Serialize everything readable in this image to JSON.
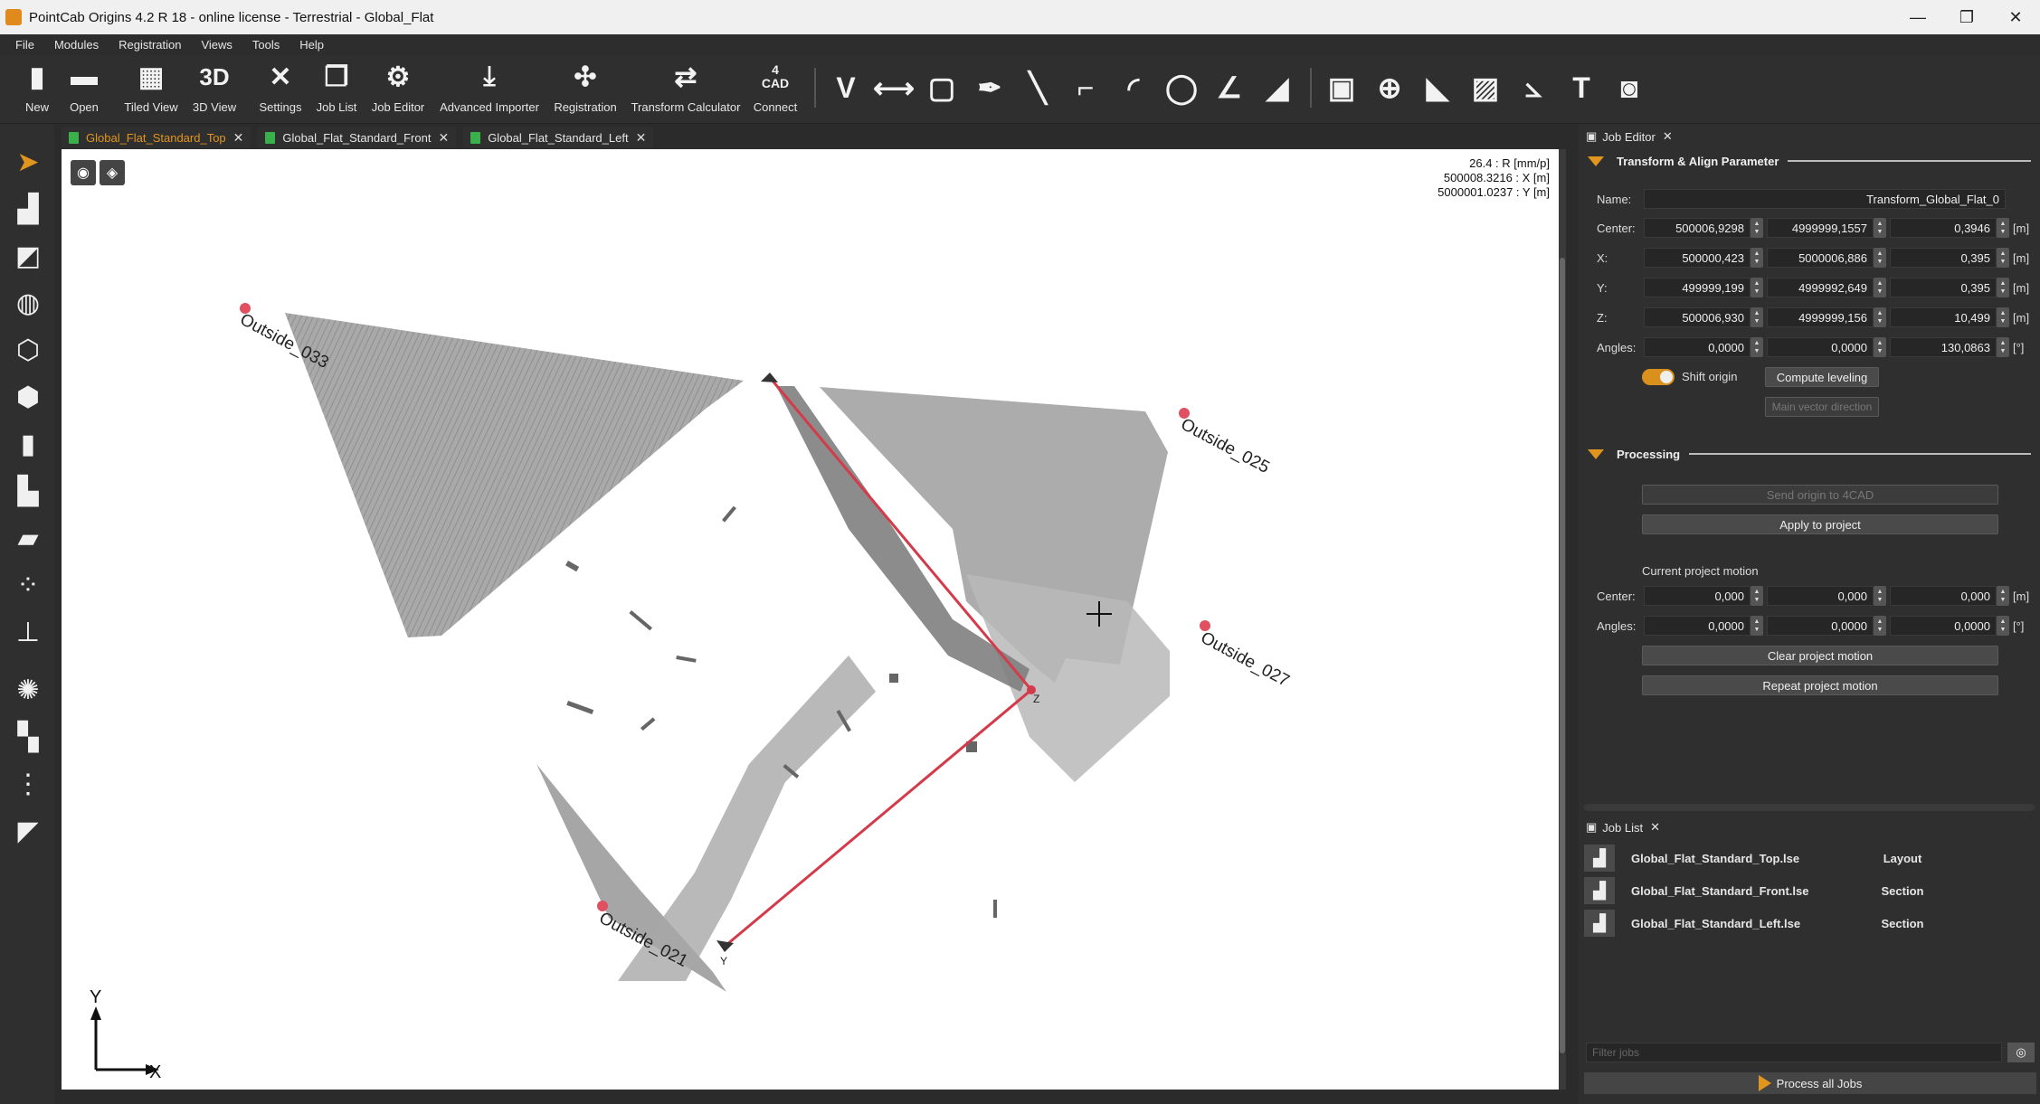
{
  "window": {
    "title": "PointCab Origins 4.2 R 18 - online license - Terrestrial - Global_Flat",
    "minimize": "—",
    "maximize": "❐",
    "close": "✕"
  },
  "menu": [
    "File",
    "Modules",
    "Registration",
    "Views",
    "Tools",
    "Help"
  ],
  "toolbar": {
    "new": "New",
    "open": "Open",
    "tiled_view": "Tiled View",
    "view3d_icon": "3D",
    "view3d": "3D View",
    "settings": "Settings",
    "job_list": "Job List",
    "job_editor": "Job Editor",
    "advanced_importer": "Advanced Importer",
    "registration": "Registration",
    "transform_calculator": "Transform Calculator",
    "connect_icon_top": "4",
    "connect_icon_bottom": "CAD",
    "connect": "Connect"
  },
  "tabs": [
    {
      "label": "Global_Flat_Standard_Top"
    },
    {
      "label": "Global_Flat_Standard_Front"
    },
    {
      "label": "Global_Flat_Standard_Left"
    }
  ],
  "viewport": {
    "resolution": "26.4 : R [mm/p]",
    "x_coord": "500008.3216 : X [m]",
    "y_coord": "5000001.0237 : Y [m]",
    "labels": {
      "outside_033": "Outside_033",
      "outside_025": "Outside_025",
      "outside_027": "Outside_027",
      "outside_021": "Outside_021",
      "z_marker": "Z",
      "y_marker": "Y",
      "axis_y": "Y",
      "axis_x": "X"
    }
  },
  "job_editor": {
    "title": "Job Editor",
    "transform_section": "Transform & Align Parameter",
    "name_label": "Name:",
    "name_value": "Transform_Global_Flat_0",
    "center_label": "Center:",
    "center": [
      "500006,9298",
      "4999999,1557",
      "0,3946"
    ],
    "x_label": "X:",
    "x": [
      "500000,423",
      "5000006,886",
      "0,395"
    ],
    "y_label": "Y:",
    "y": [
      "499999,199",
      "4999992,649",
      "0,395"
    ],
    "z_label": "Z:",
    "z": [
      "500006,930",
      "4999999,156",
      "10,499"
    ],
    "angles_label": "Angles:",
    "angles": [
      "0,0000",
      "0,0000",
      "130,0863"
    ],
    "unit_m": "[m]",
    "unit_deg": "[°]",
    "shift_origin": "Shift origin",
    "compute_leveling": "Compute leveling",
    "main_vector_direction": "Main vector direction",
    "processing_section": "Processing",
    "send_origin": "Send origin to 4CAD",
    "apply_to_project": "Apply to project",
    "current_motion": "Current project motion",
    "motion_center": [
      "0,000",
      "0,000",
      "0,000"
    ],
    "motion_angles": [
      "0,0000",
      "0,0000",
      "0,0000"
    ],
    "clear_motion": "Clear project motion",
    "repeat_motion": "Repeat project motion"
  },
  "job_list": {
    "title": "Job List",
    "jobs": [
      {
        "name": "Global_Flat_Standard_Top.lse",
        "type": "Layout"
      },
      {
        "name": "Global_Flat_Standard_Front.lse",
        "type": "Section"
      },
      {
        "name": "Global_Flat_Standard_Left.lse",
        "type": "Section"
      }
    ],
    "filter_placeholder": "Filter jobs",
    "process_all": "Process all Jobs"
  },
  "colors": {
    "accent": "#e0951e",
    "red_line": "#d43b4a",
    "tab_doc": "#39b04a"
  }
}
